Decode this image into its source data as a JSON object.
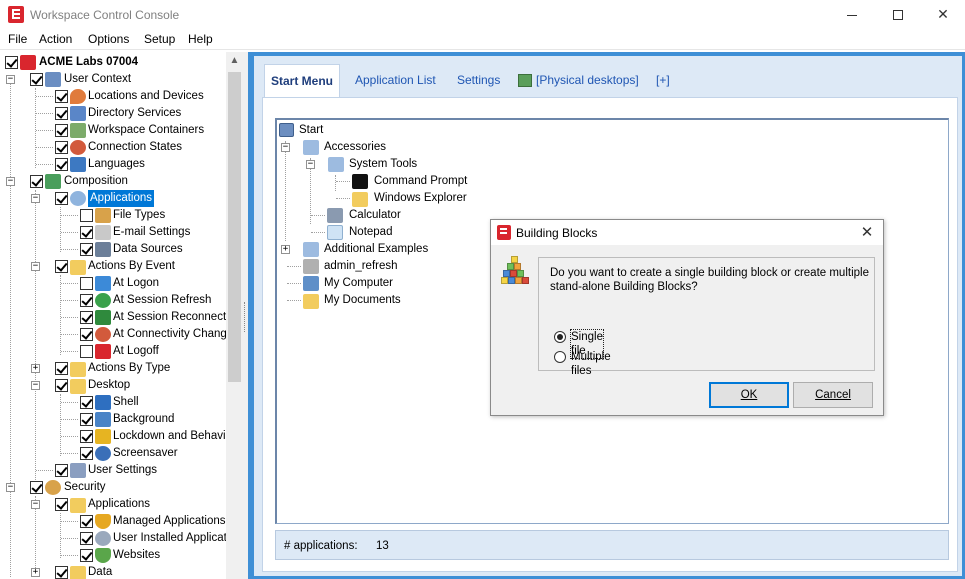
{
  "window": {
    "title": "Workspace Control Console",
    "controls": {
      "minimize": "minimize-icon",
      "maximize": "maximize-icon",
      "close": "close-icon"
    }
  },
  "menu": [
    "File",
    "Action",
    "Options",
    "Setup",
    "Help"
  ],
  "tree": {
    "root": "ACME Labs 07004",
    "items": [
      "User Context",
      "Locations and Devices",
      "Directory Services",
      "Workspace Containers",
      "Connection States",
      "Languages",
      "Composition",
      "Applications",
      "File Types",
      "E-mail Settings",
      "Data Sources",
      "Actions By Event",
      "At Logon",
      "At Session Refresh",
      "At Session Reconnect",
      "At Connectivity Change",
      "At Logoff",
      "Actions By Type",
      "Desktop",
      "Shell",
      "Background",
      "Lockdown and Behavior",
      "Screensaver",
      "User Settings",
      "Security",
      "Applications",
      "Managed Applications",
      "User Installed Applications",
      "Websites",
      "Data"
    ]
  },
  "tabs": [
    "Start Menu",
    "Application List",
    "Settings",
    "[Physical desktops]",
    "[+]"
  ],
  "startmenu": {
    "items": [
      "Start",
      "Accessories",
      "System Tools",
      "Command Prompt",
      "Windows Explorer",
      "Calculator",
      "Notepad",
      "Additional Examples",
      "admin_refresh",
      "My Computer",
      "My Documents"
    ]
  },
  "status": {
    "label": "# applications:",
    "count": "13"
  },
  "dialog": {
    "title": "Building Blocks",
    "message": "Do you want to create a single building block or create multiple stand-alone Building Blocks?",
    "options": [
      "Single file",
      "Multiple files"
    ],
    "selected": "Single file",
    "ok": "OK",
    "cancel": "Cancel"
  },
  "colors": {
    "accent": "#3e8fd6",
    "selection": "#0078d7",
    "brand": "#d9262e"
  }
}
